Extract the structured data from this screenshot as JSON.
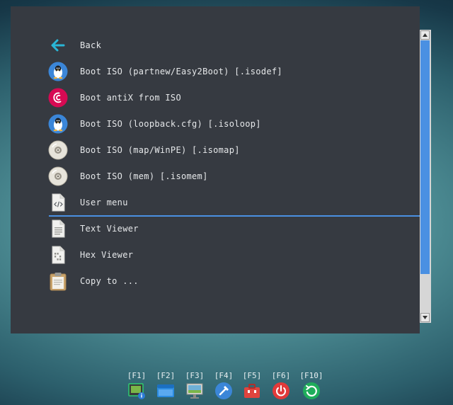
{
  "menu": {
    "items": [
      {
        "label": "Back",
        "icon": "back-arrow-icon"
      },
      {
        "label": "Boot ISO (partnew/Easy2Boot) [.isodef]",
        "icon": "linux-tux-icon"
      },
      {
        "label": "Boot antiX from ISO",
        "icon": "debian-swirl-icon"
      },
      {
        "label": "Boot ISO (loopback.cfg) [.isoloop]",
        "icon": "linux-tux-icon"
      },
      {
        "label": "Boot ISO (map/WinPE) [.isomap]",
        "icon": "disc-icon"
      },
      {
        "label": "Boot ISO (mem) [.isomem]",
        "icon": "disc-icon"
      },
      {
        "label": "User menu",
        "icon": "code-file-icon"
      },
      {
        "label": "Text Viewer",
        "icon": "text-file-icon"
      },
      {
        "label": "Hex Viewer",
        "icon": "hex-file-icon"
      },
      {
        "label": "Copy to ...",
        "icon": "clipboard-icon"
      }
    ],
    "selected_item": "User menu"
  },
  "scrollbar": {
    "position_fraction": 0.0,
    "visible_fraction": 0.86
  },
  "function_keys": [
    {
      "label": "[F1]",
      "icon": "system-info-icon"
    },
    {
      "label": "[F2]",
      "icon": "window-icon"
    },
    {
      "label": "[F3]",
      "icon": "display-settings-icon"
    },
    {
      "label": "[F4]",
      "icon": "tools-hammer-icon"
    },
    {
      "label": "[F5]",
      "icon": "toolbox-icon"
    },
    {
      "label": "[F6]",
      "icon": "power-icon"
    },
    {
      "label": "[F10]",
      "icon": "restart-icon"
    }
  ],
  "colors": {
    "panel_bg": "#363a41",
    "accent_blue": "#4a90e2",
    "back_arrow": "#29b6d6",
    "text": "#e6e8ea"
  }
}
